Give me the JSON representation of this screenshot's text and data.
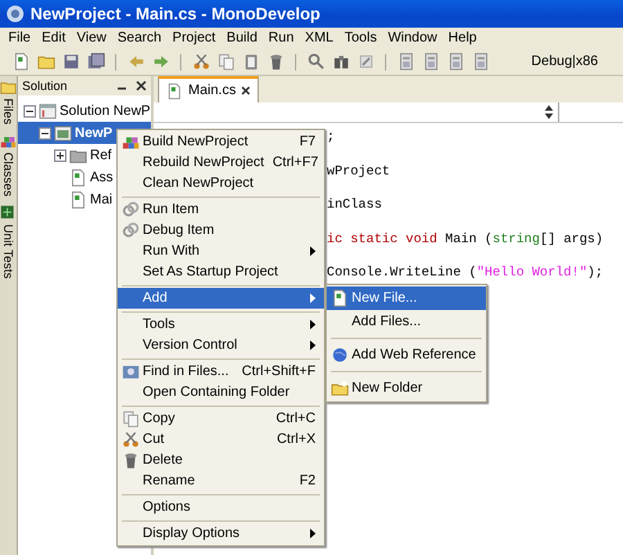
{
  "window": {
    "title": "NewProject - Main.cs - MonoDevelop"
  },
  "menu_bar": [
    "File",
    "Edit",
    "View",
    "Search",
    "Project",
    "Build",
    "Run",
    "XML",
    "Tools",
    "Window",
    "Help"
  ],
  "toolbar": {
    "configuration": "Debug|x86"
  },
  "side_tabs": [
    {
      "label": "Files"
    },
    {
      "label": "Classes"
    },
    {
      "label": "Unit Tests"
    }
  ],
  "solution_pad": {
    "title": "Solution",
    "tree": [
      {
        "label": "Solution NewP",
        "kind": "solution",
        "expanded": true,
        "selected": false,
        "children": [
          {
            "label": "NewP",
            "kind": "project",
            "expanded": true,
            "selected": true,
            "children": [
              {
                "label": "Ref",
                "kind": "folder",
                "expanded": false,
                "selected": false
              },
              {
                "label": "Ass",
                "kind": "file",
                "selected": false
              },
              {
                "label": "Mai",
                "kind": "file",
                "selected": false
              }
            ]
          }
        ]
      }
    ]
  },
  "editor": {
    "tabs": [
      {
        "label": "Main.cs",
        "selected": true
      }
    ],
    "code_lines": [
      [
        {
          "text": ";",
          "kind": "plain"
        }
      ],
      [
        {
          "text": "wProject",
          "kind": "plain"
        }
      ],
      [
        {
          "text": "inClass",
          "kind": "plain"
        }
      ],
      [
        {
          "text": "ic static void",
          "kind": "keyword"
        },
        {
          "text": " Main (",
          "kind": "plain"
        },
        {
          "text": "string",
          "kind": "type"
        },
        {
          "text": "[] args)",
          "kind": "plain"
        }
      ],
      [
        {
          "text": "Console.WriteLine (",
          "kind": "plain"
        },
        {
          "text": "\"Hello World!\"",
          "kind": "string"
        },
        {
          "text": ");",
          "kind": "plain"
        }
      ]
    ]
  },
  "context_menu": [
    {
      "kind": "item",
      "label": "Build NewProject",
      "shortcut": "F7",
      "submenu": false,
      "selected": false
    },
    {
      "kind": "item",
      "label": "Rebuild NewProject",
      "shortcut": "Ctrl+F7",
      "submenu": false,
      "selected": false
    },
    {
      "kind": "item",
      "label": "Clean NewProject",
      "submenu": false,
      "selected": false
    },
    {
      "kind": "separator"
    },
    {
      "kind": "item",
      "label": "Run Item",
      "submenu": false,
      "selected": false
    },
    {
      "kind": "item",
      "label": "Debug Item",
      "submenu": false,
      "selected": false
    },
    {
      "kind": "item",
      "label": "Run With",
      "submenu": true,
      "selected": false
    },
    {
      "kind": "item",
      "label": "Set As Startup Project",
      "submenu": false,
      "selected": false
    },
    {
      "kind": "separator"
    },
    {
      "kind": "item",
      "label": "Add",
      "submenu": true,
      "selected": true
    },
    {
      "kind": "separator"
    },
    {
      "kind": "item",
      "label": "Tools",
      "submenu": true,
      "selected": false
    },
    {
      "kind": "item",
      "label": "Version Control",
      "submenu": true,
      "selected": false
    },
    {
      "kind": "separator"
    },
    {
      "kind": "item",
      "label": "Find in Files...",
      "shortcut": "Ctrl+Shift+F",
      "submenu": false,
      "selected": false
    },
    {
      "kind": "item",
      "label": "Open Containing Folder",
      "submenu": false,
      "selected": false
    },
    {
      "kind": "separator"
    },
    {
      "kind": "item",
      "label": "Copy",
      "shortcut": "Ctrl+C",
      "submenu": false,
      "selected": false
    },
    {
      "kind": "item",
      "label": "Cut",
      "shortcut": "Ctrl+X",
      "submenu": false,
      "selected": false
    },
    {
      "kind": "item",
      "label": "Delete",
      "submenu": false,
      "selected": false
    },
    {
      "kind": "item",
      "label": "Rename",
      "shortcut": "F2",
      "submenu": false,
      "selected": false
    },
    {
      "kind": "separator"
    },
    {
      "kind": "item",
      "label": "Options",
      "submenu": false,
      "selected": false
    },
    {
      "kind": "separator"
    },
    {
      "kind": "item",
      "label": "Display Options",
      "submenu": true,
      "selected": false
    }
  ],
  "add_submenu": [
    {
      "kind": "item",
      "label": "New File...",
      "selected": true
    },
    {
      "kind": "item",
      "label": "Add Files...",
      "selected": false
    },
    {
      "kind": "separator"
    },
    {
      "kind": "item",
      "label": "Add Web Reference",
      "selected": false
    },
    {
      "kind": "separator"
    },
    {
      "kind": "item",
      "label": "New Folder",
      "selected": false
    }
  ]
}
